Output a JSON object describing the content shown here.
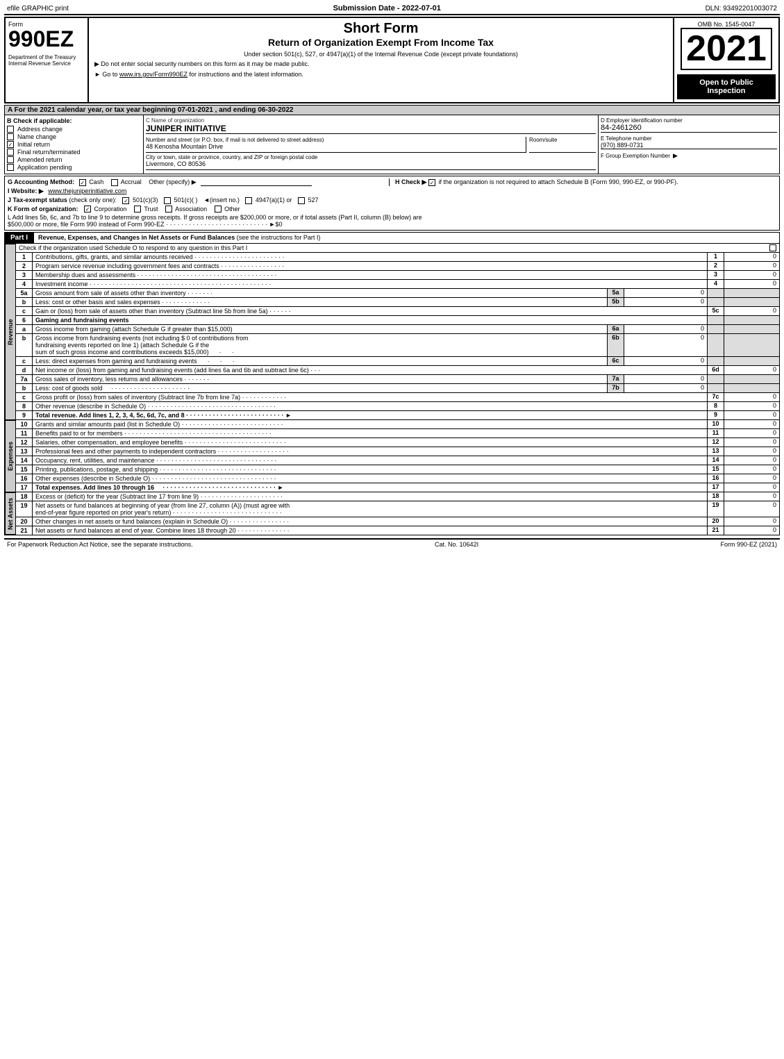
{
  "topBar": {
    "left": "efile GRAPHIC print",
    "center": "Submission Date - 2022-07-01",
    "right": "DLN: 93492201003072"
  },
  "formNumber": "990EZ",
  "titles": {
    "main": "Short Form",
    "sub": "Return of Organization Exempt From Income Tax",
    "line1": "Under section 501(c), 527, or 4947(a)(1) of the Internal Revenue Code (except private foundations)",
    "line2": "▶ Do not enter social security numbers on this form as it may be made public.",
    "line3": "▶ Go to www.irs.gov/Form990EZ for instructions and the latest information."
  },
  "year": "2021",
  "omb": "OMB No. 1545-0047",
  "openToPublic": "Open to Public Inspection",
  "leftInfo": {
    "dept": "Department of the Treasury",
    "irs": "Internal Revenue Service"
  },
  "sectionA": {
    "header": "A For the 2021 calendar year, or tax year beginning 07-01-2021 , and ending 06-30-2022",
    "b_label": "B Check if applicable:",
    "checkboxes": [
      {
        "label": "Address change",
        "checked": false
      },
      {
        "label": "Name change",
        "checked": false
      },
      {
        "label": "Initial return",
        "checked": true
      },
      {
        "label": "Final return/terminated",
        "checked": false
      },
      {
        "label": "Amended return",
        "checked": false
      },
      {
        "label": "Application pending",
        "checked": false
      }
    ],
    "c_label": "C Name of organization",
    "org_name": "JUNIPER INITIATIVE",
    "address_label": "Number and street (or P.O. box, if mail is not delivered to street address)",
    "address": "48 Kenosha Mountain Drive",
    "room_label": "Room/suite",
    "room": "",
    "city_label": "City or town, state or province, country, and ZIP or foreign postal code",
    "city": "Livermore, CO  80536",
    "d_label": "D Employer identification number",
    "ein": "84-2461260",
    "e_label": "E Telephone number",
    "phone": "(970) 889-0731",
    "f_label": "F Group Exemption Number",
    "f_arrow": "▶"
  },
  "sectionG": {
    "label": "G Accounting Method:",
    "cash": "Cash",
    "accrual": "Accrual",
    "other": "Other (specify) ▶",
    "cash_checked": true,
    "accrual_checked": false
  },
  "sectionH": {
    "label": "H Check ▶",
    "checked": true,
    "text": "if the organization is not required to attach Schedule B (Form 990, 990-EZ, or 990-PF)."
  },
  "sectionI": {
    "label": "I Website: ▶",
    "url": "www.thejuniperinitiative.com"
  },
  "sectionJ": {
    "label": "J Tax-exempt status",
    "note": "(check only one):",
    "options": [
      "501(c)(3)",
      "501(c)(  )",
      "▼(insert no.)",
      "4947(a)(1) or",
      "527"
    ],
    "checked": "501(c)(3)"
  },
  "sectionK": {
    "label": "K Form of organization:",
    "options": [
      "Corporation",
      "Trust",
      "Association",
      "Other"
    ],
    "checked": "Corporation"
  },
  "sectionL": {
    "text": "L Add lines 5b, 6c, and 7b to line 9 to determine gross receipts. If gross receipts are $200,000 or more, or if total assets (Part II, column (B) below) are $500,000 or more, file Form 990 instead of Form 990-EZ",
    "dots": "· · · · · · · · · · · · · · · · · · · · · · · · · · · ·",
    "arrow": "▶$0"
  },
  "part1": {
    "header": "Part I",
    "title": "Revenue, Expenses, and Changes in Net Assets or Fund Balances",
    "subtitle": "(see the instructions for Part I)",
    "checkLine": "Check if the organization used Schedule O to respond to any question in this Part I",
    "lines": [
      {
        "num": "1",
        "desc": "Contributions, gifts, grants, and similar amounts received",
        "dots": true,
        "lineNum": "1",
        "value": "0"
      },
      {
        "num": "2",
        "desc": "Program service revenue including government fees and contracts",
        "dots": true,
        "lineNum": "2",
        "value": "0"
      },
      {
        "num": "3",
        "desc": "Membership dues and assessments",
        "dots": true,
        "lineNum": "3",
        "value": "0"
      },
      {
        "num": "4",
        "desc": "Investment income",
        "dots": true,
        "lineNum": "4",
        "value": "0"
      },
      {
        "num": "5a",
        "desc": "Gross amount from sale of assets other than inventory",
        "code": "5a",
        "midValue": "0",
        "lineNum": "",
        "value": ""
      },
      {
        "num": "b",
        "desc": "Less: cost or other basis and sales expenses",
        "code": "5b",
        "midValue": "0",
        "lineNum": "",
        "value": ""
      },
      {
        "num": "c",
        "desc": "Gain or (loss) from sale of assets other than inventory (Subtract line 5b from line 5a)",
        "dots": true,
        "lineNum": "5c",
        "value": "0"
      },
      {
        "num": "6",
        "desc": "Gaming and fundraising events",
        "lineNum": "",
        "value": ""
      },
      {
        "num": "a",
        "desc": "Gross income from gaming (attach Schedule G if greater than $15,000)",
        "code": "6a",
        "midValue": "0",
        "lineNum": "",
        "value": ""
      },
      {
        "num": "b",
        "desc": "Gross income from fundraising events (not including $  0  of contributions from fundraising events reported on line 1) (attach Schedule G if the sum of such gross income and contributions exceeds $15,000)",
        "code": "6b",
        "midValue": "0",
        "lineNum": "",
        "value": "",
        "multiline": true
      },
      {
        "num": "c",
        "desc": "Less: direct expenses from gaming and fundraising events",
        "code": "6c",
        "midValue": "0",
        "lineNum": "",
        "value": ""
      },
      {
        "num": "d",
        "desc": "Net income or (loss) from gaming and fundraising events (add lines 6a and 6b and subtract line 6c)",
        "dots": true,
        "lineNum": "6d",
        "value": "0"
      },
      {
        "num": "7a",
        "desc": "Gross sales of inventory, less returns and allowances",
        "code": "7a",
        "midValue": "0",
        "lineNum": "",
        "value": ""
      },
      {
        "num": "b",
        "desc": "Less: cost of goods sold",
        "code": "7b",
        "midValue": "0",
        "lineNum": "",
        "value": ""
      },
      {
        "num": "c",
        "desc": "Gross profit or (loss) from sales of inventory (Subtract line 7b from line 7a)",
        "dots": true,
        "lineNum": "7c",
        "value": "0"
      },
      {
        "num": "8",
        "desc": "Other revenue (describe in Schedule O)",
        "dots": true,
        "lineNum": "8",
        "value": "0"
      },
      {
        "num": "9",
        "bold": true,
        "desc": "Total revenue. Add lines 1, 2, 3, 4, 5c, 6d, 7c, and 8",
        "dots": true,
        "arrow": "▶",
        "lineNum": "9",
        "value": "0"
      }
    ]
  },
  "part1expenses": {
    "sideLabel": "Expenses",
    "lines": [
      {
        "num": "10",
        "desc": "Grants and similar amounts paid (list in Schedule O)",
        "dots": true,
        "lineNum": "10",
        "value": "0"
      },
      {
        "num": "11",
        "desc": "Benefits paid to or for members",
        "dots": true,
        "lineNum": "11",
        "value": "0"
      },
      {
        "num": "12",
        "desc": "Salaries, other compensation, and employee benefits",
        "dots": true,
        "lineNum": "12",
        "value": "0"
      },
      {
        "num": "13",
        "desc": "Professional fees and other payments to independent contractors",
        "dots": true,
        "lineNum": "13",
        "value": "0"
      },
      {
        "num": "14",
        "desc": "Occupancy, rent, utilities, and maintenance",
        "dots": true,
        "lineNum": "14",
        "value": "0"
      },
      {
        "num": "15",
        "desc": "Printing, publications, postage, and shipping",
        "dots": true,
        "lineNum": "15",
        "value": "0"
      },
      {
        "num": "16",
        "desc": "Other expenses (describe in Schedule O)",
        "dots": true,
        "lineNum": "16",
        "value": "0"
      },
      {
        "num": "17",
        "bold": true,
        "desc": "Total expenses. Add lines 10 through 16",
        "dots": true,
        "arrow": "▶",
        "lineNum": "17",
        "value": "0"
      }
    ]
  },
  "part1netAssets": {
    "sideLabel": "Net Assets",
    "lines": [
      {
        "num": "18",
        "desc": "Excess or (deficit) for the year (Subtract line 17 from line 9)",
        "dots": true,
        "lineNum": "18",
        "value": "0"
      },
      {
        "num": "19",
        "desc": "Net assets or fund balances at beginning of year (from line 27, column (A)) (must agree with end-of-year figure reported on prior year's return)",
        "dots": true,
        "lineNum": "19",
        "value": "0",
        "multiline": true
      },
      {
        "num": "20",
        "desc": "Other changes in net assets or fund balances (explain in Schedule O)",
        "dots": true,
        "lineNum": "20",
        "value": "0"
      },
      {
        "num": "21",
        "desc": "Net assets or fund balances at end of year. Combine lines 18 through 20",
        "dots": true,
        "lineNum": "21",
        "value": "0"
      }
    ]
  },
  "footer": {
    "left": "For Paperwork Reduction Act Notice, see the separate instructions.",
    "center": "Cat. No. 10642I",
    "right": "Form 990-EZ (2021)"
  }
}
